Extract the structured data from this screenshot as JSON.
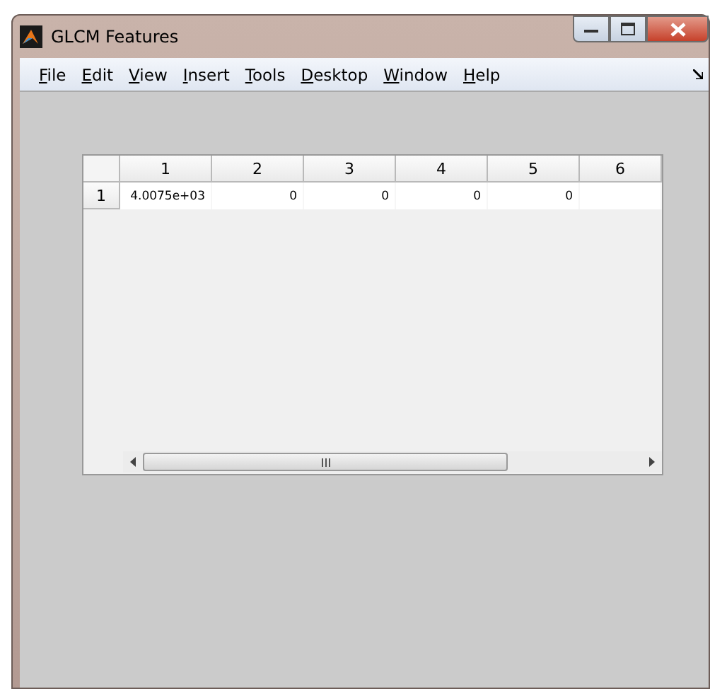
{
  "window": {
    "title": "GLCM Features"
  },
  "menu": [
    "File",
    "Edit",
    "View",
    "Insert",
    "Tools",
    "Desktop",
    "Window",
    "Help"
  ],
  "table": {
    "columns": [
      "1",
      "2",
      "3",
      "4",
      "5",
      "6"
    ],
    "rows": [
      {
        "header": "1",
        "cells": [
          "4.0075e+03",
          "0",
          "0",
          "0",
          "0",
          ""
        ]
      }
    ]
  }
}
